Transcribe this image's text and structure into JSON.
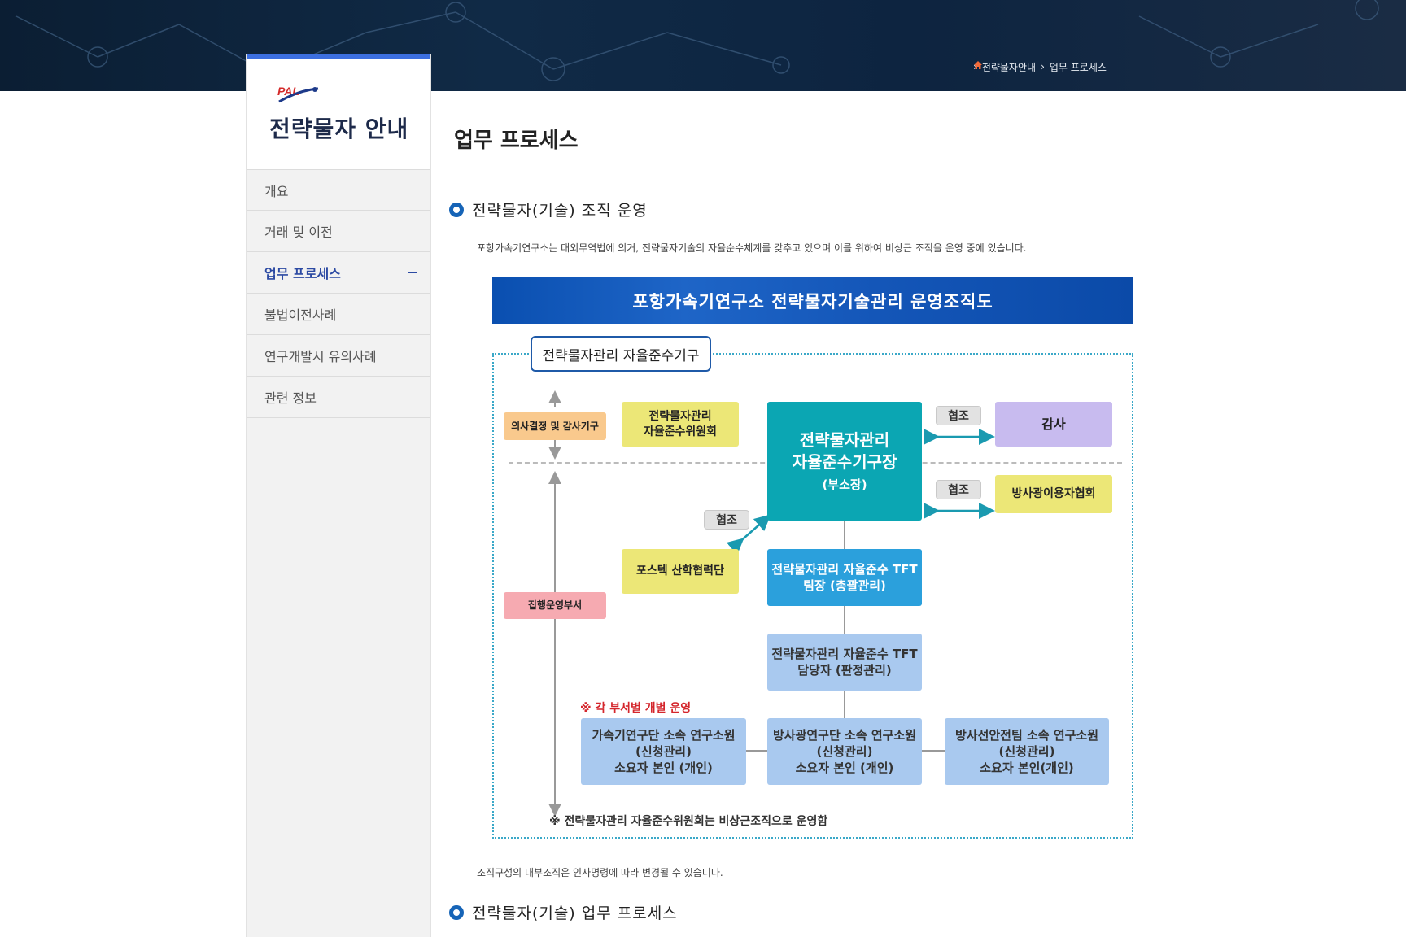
{
  "breadcrumb": {
    "items": [
      "전략물자안내",
      "업무 프로세스"
    ]
  },
  "sidebar": {
    "logo_text": "PAL",
    "title": "전략물자 안내",
    "items": [
      {
        "label": "개요"
      },
      {
        "label": "거래 및 이전"
      },
      {
        "label": "업무 프로세스",
        "active": true
      },
      {
        "label": "불법이전사례"
      },
      {
        "label": "연구개발시 유의사례"
      },
      {
        "label": "관련 정보"
      }
    ]
  },
  "main": {
    "page_title": "업무 프로세스",
    "section1": {
      "title": "전략물자(기술) 조직 운영",
      "desc": "포항가속기연구소는 대외무역법에 의거, 전략물자기술의 자율순수체계를 갖추고 있으며 이를 위하여 비상근 조직을 운영 중에 있습니다."
    },
    "chart": {
      "banner": "포항가속기연구소 전략물자기술관리 운영조직도",
      "frame_label": "전략물자관리 자율준수기구",
      "decision_label": "의사결정 및 감사기구",
      "committee": [
        "전략물자관리",
        "자율준수위원회"
      ],
      "director": [
        "전략물자관리",
        "자율준수기구장",
        "(부소장)"
      ],
      "coop": "협조",
      "audit": "감사",
      "association": "방사광이용자협회",
      "postech": "포스텍 산학협력단",
      "tft_leader": [
        "전략물자관리 자율준수 TFT",
        "팀장 (총괄관리)"
      ],
      "tft_staff": [
        "전략물자관리 자율준수 TFT",
        "담당자 (판정관리)"
      ],
      "exec_label": "집행운영부서",
      "dept_note": "※ 각 부서별 개별 운영",
      "depts": [
        [
          "가속기연구단 소속 연구소원",
          "(신청관리)",
          "소요자 본인 (개인)"
        ],
        [
          "방사광연구단 소속 연구소원",
          "(신청관리)",
          "소요자 본인 (개인)"
        ],
        [
          "방사선안전팀 소속 연구소원",
          "(신청관리)",
          "소요자 본인(개인)"
        ]
      ],
      "footnote": "※ 전략물자관리 자율준수위원회는 비상근조직으로 운영함"
    },
    "after_note": "조직구성의 내부조직은 인사명령에 따라 변경될 수 있습니다.",
    "section2": {
      "title": "전략물자(기술) 업무 프로세스"
    }
  }
}
